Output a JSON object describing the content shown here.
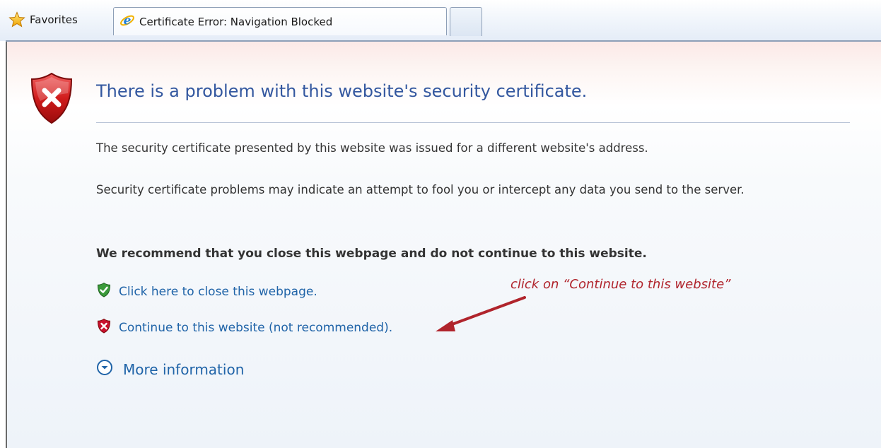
{
  "browser": {
    "favorites_label": "Favorites",
    "active_tab_title": "Certificate Error: Navigation Blocked"
  },
  "page": {
    "title": "There is a problem with this website's security certificate.",
    "paragraph1": "The security certificate presented by this website was issued for a different website's address.",
    "paragraph2": "Security certificate problems may indicate an attempt to fool you or intercept any data you send to the server.",
    "recommendation": "We recommend that you close this webpage and do not continue to this website.",
    "close_link": "Click here to close this webpage.",
    "continue_link": "Continue to this website (not recommended).",
    "more_info": "More information"
  },
  "annotation": {
    "text": "click on “Continue to this website”",
    "color": "#b0242c"
  },
  "colors": {
    "title": "#33579f",
    "link": "#2064a8",
    "error_red": "#c8102e",
    "ok_green": "#3a9a3a"
  },
  "icons": {
    "favorites": "star-icon",
    "tab": "ie-logo-icon",
    "error": "red-shield-x-icon",
    "close": "green-shield-check-icon",
    "continue": "red-shield-x-icon",
    "more": "chevron-down-circle-icon"
  }
}
